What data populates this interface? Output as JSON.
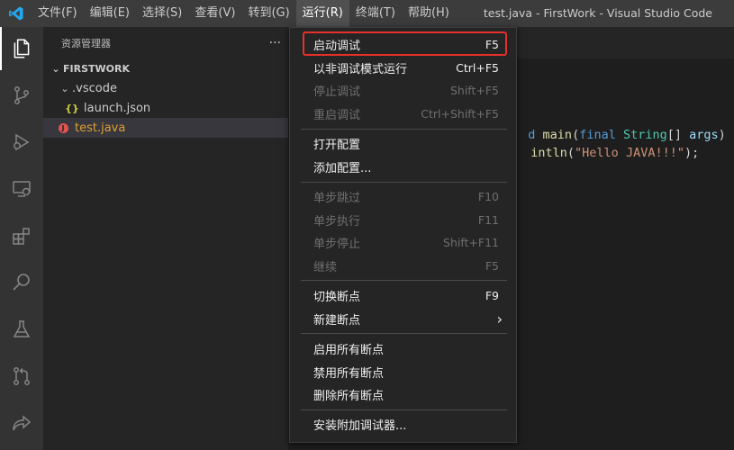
{
  "titlebar": {
    "window_title": "test.java - FirstWork - Visual Studio Code",
    "menus": [
      "文件(F)",
      "编辑(E)",
      "选择(S)",
      "查看(V)",
      "转到(G)",
      "运行(R)",
      "终端(T)",
      "帮助(H)"
    ]
  },
  "sidebar": {
    "title": "资源管理器",
    "more": "···",
    "section": "FIRSTWORK",
    "folder": ".vscode",
    "file_launch": "launch.json",
    "file_test": "test.java",
    "launch_icon_glyph": "{}",
    "test_icon_glyph": "J"
  },
  "editor": {
    "line1": "d main(final String[] args) {",
    "line2": "intln(\"Hello JAVA!!!\");"
  },
  "run_menu": {
    "items": [
      {
        "label": "启动调试",
        "key": "F5"
      },
      {
        "label": "以非调试模式运行",
        "key": "Ctrl+F5"
      },
      {
        "label": "停止调试",
        "key": "Shift+F5"
      },
      {
        "label": "重启调试",
        "key": "Ctrl+Shift+F5"
      },
      {
        "label": "打开配置",
        "key": ""
      },
      {
        "label": "添加配置...",
        "key": ""
      },
      {
        "label": "单步跳过",
        "key": "F10"
      },
      {
        "label": "单步执行",
        "key": "F11"
      },
      {
        "label": "单步停止",
        "key": "Shift+F11"
      },
      {
        "label": "继续",
        "key": "F5"
      },
      {
        "label": "切换断点",
        "key": "F9"
      },
      {
        "label": "新建断点",
        "key": ""
      },
      {
        "label": "启用所有断点",
        "key": ""
      },
      {
        "label": "禁用所有断点",
        "key": ""
      },
      {
        "label": "删除所有断点",
        "key": ""
      },
      {
        "label": "安装附加调试器...",
        "key": ""
      }
    ],
    "submenu_arrow": "›"
  },
  "colors": {
    "accent_blue": "#23a9f2",
    "highlight_red": "#e5302b",
    "java_red": "#e05353",
    "json_yellow": "#cbcb41"
  }
}
